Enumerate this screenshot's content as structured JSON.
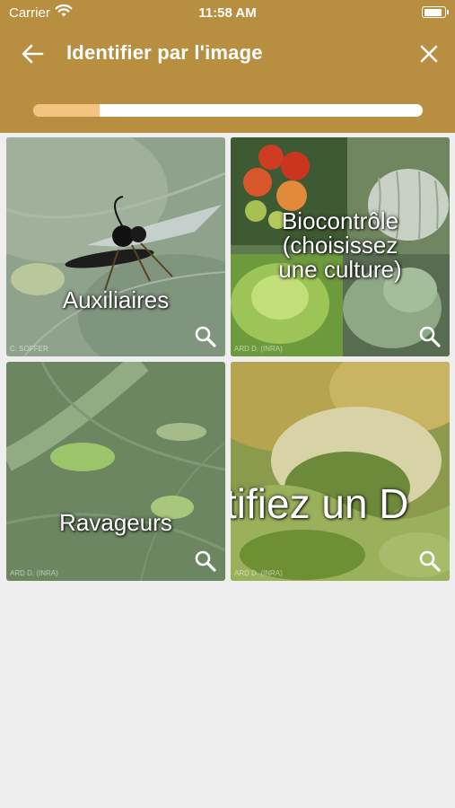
{
  "status_bar": {
    "carrier": "Carrier",
    "time": "11:58 AM",
    "battery_level": 0.9
  },
  "nav": {
    "back_icon": "arrow-left-icon",
    "title": "Identifier par l'image",
    "close_icon": "close-icon"
  },
  "progress": {
    "value": 0.17
  },
  "tiles": [
    {
      "label": "Auxiliaires",
      "credit": "C. SOFFER",
      "icon": "magnifier-icon"
    },
    {
      "label": "Biocontrôle\n(choisissez\nune culture)",
      "credit": "ARD D. (INRA)",
      "icon": "magnifier-icon"
    },
    {
      "label": "Ravageurs",
      "credit": "ARD D. (INRA)",
      "icon": "magnifier-icon"
    },
    {
      "label": "tifiez un D",
      "credit": "ARD D. (INRA)",
      "icon": "magnifier-icon"
    }
  ],
  "colors": {
    "header": "#b88e40",
    "progress_fill": "#f2c47f",
    "background": "#eeeeee"
  }
}
